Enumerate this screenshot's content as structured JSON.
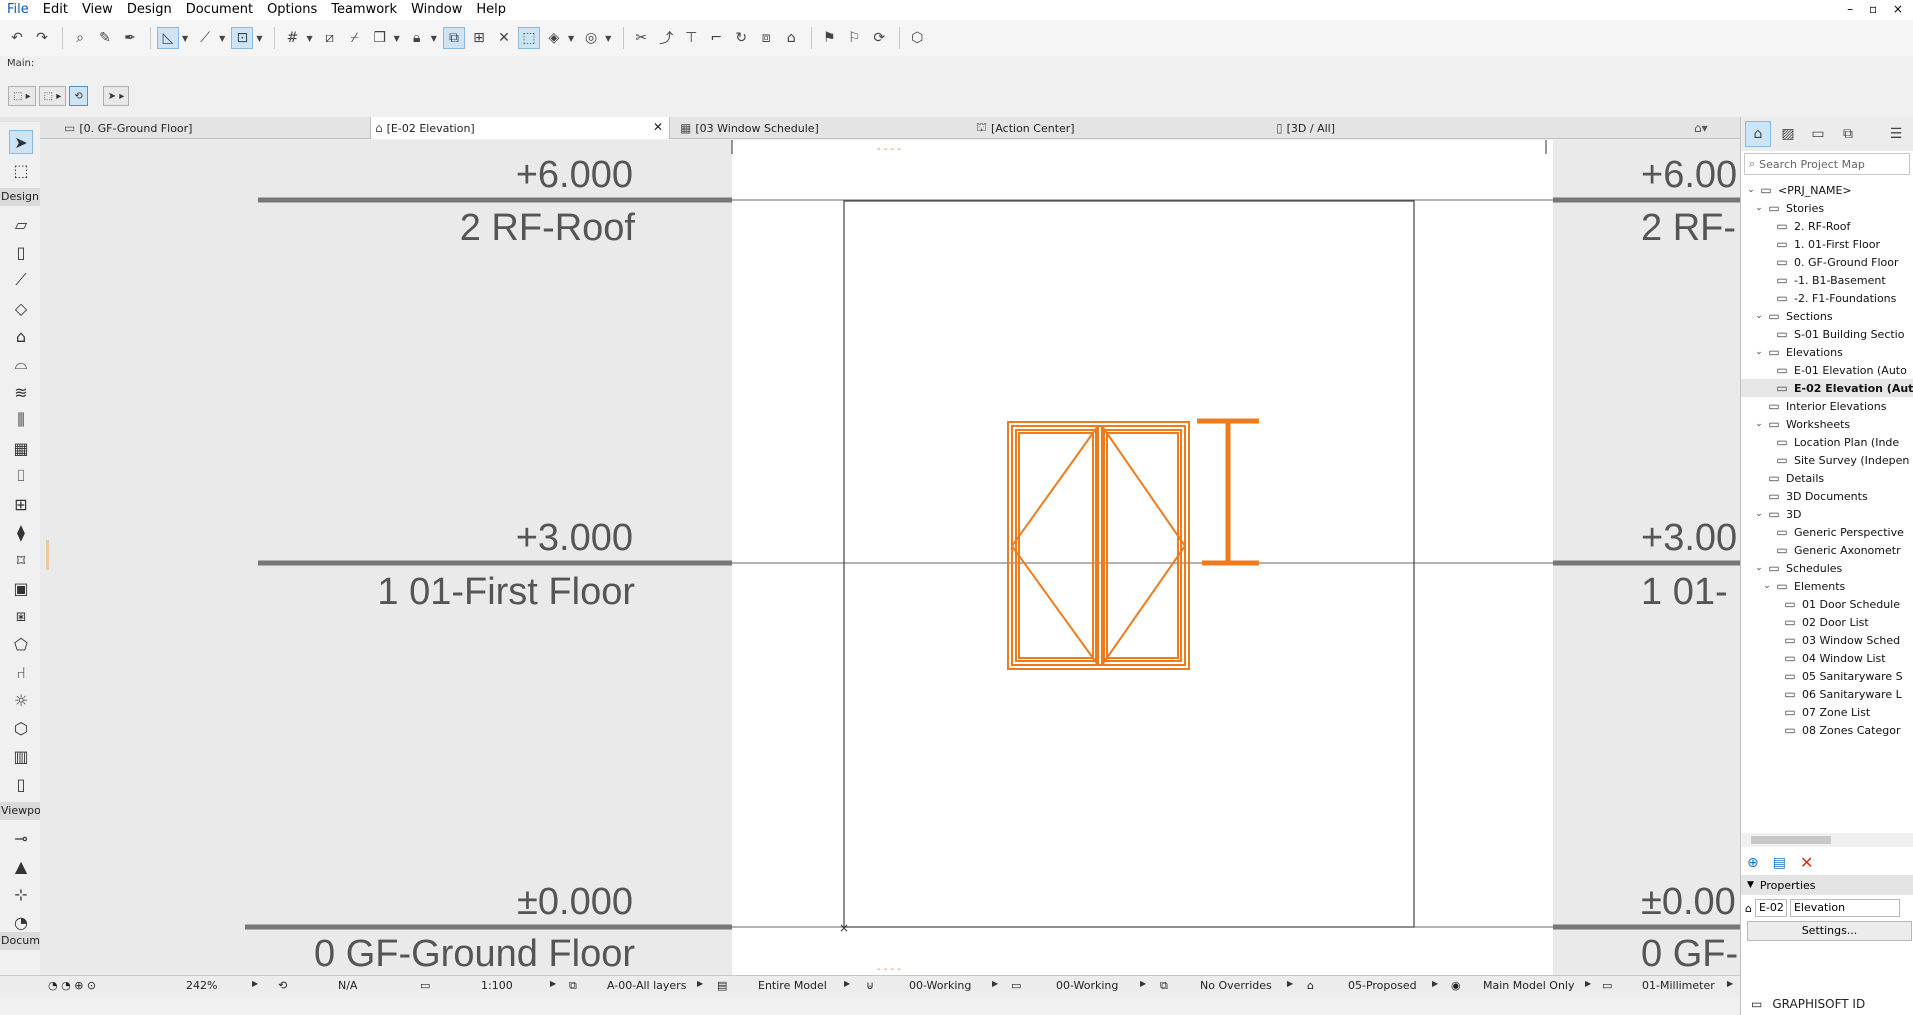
{
  "menubar": {
    "items": [
      "File",
      "Edit",
      "View",
      "Design",
      "Document",
      "Options",
      "Teamwork",
      "Window",
      "Help"
    ],
    "window_controls": "– ▫ ×"
  },
  "toolbar": {
    "main_label": "Main:"
  },
  "tabs": [
    {
      "label": "[0. GF-Ground Floor]",
      "icon": "floor-plan-icon"
    },
    {
      "label": "[E-02 Elevation]",
      "icon": "elevation-icon",
      "active": true
    },
    {
      "label": "[03 Window Schedule]",
      "icon": "schedule-icon"
    },
    {
      "label": "[Action Center]",
      "icon": "action-center-icon"
    },
    {
      "label": "[3D / All]",
      "icon": "3d-icon"
    }
  ],
  "left_toolbox": {
    "design_label": "Design",
    "viewpoint_label": "Viewpoi",
    "document_label": "Docume"
  },
  "canvas": {
    "levels_left": [
      {
        "elevation": "+6.000",
        "name": "2 RF-Roof"
      },
      {
        "elevation": "+3.000",
        "name": "1 01-First Floor"
      },
      {
        "elevation": "±0.000",
        "name": "0 GF-Ground Floor"
      }
    ],
    "levels_right": [
      {
        "elevation": "+6.00",
        "name": "2 RF-"
      },
      {
        "elevation": "+3.00",
        "name": "1 01-"
      },
      {
        "elevation": "±0.00",
        "name": "0 GF-"
      }
    ],
    "highlight_color": "#f07b1c"
  },
  "navigator": {
    "search_placeholder": "Search Project Map",
    "tree": [
      {
        "label": "<PRJ_NAME>",
        "level": 0,
        "caret": "v",
        "icon": "project-icon"
      },
      {
        "label": "Stories",
        "level": 1,
        "caret": "v",
        "icon": "stories-icon"
      },
      {
        "label": "2. RF-Roof",
        "level": 2,
        "caret": "",
        "icon": "story-icon"
      },
      {
        "label": "1. 01-First Floor",
        "level": 2,
        "caret": "",
        "icon": "story-icon"
      },
      {
        "label": "0. GF-Ground Floor",
        "level": 2,
        "caret": "",
        "icon": "story-icon"
      },
      {
        "label": "-1. B1-Basement",
        "level": 2,
        "caret": "",
        "icon": "story-icon"
      },
      {
        "label": "-2. F1-Foundations",
        "level": 2,
        "caret": "",
        "icon": "story-icon"
      },
      {
        "label": "Sections",
        "level": 1,
        "caret": "v",
        "icon": "section-icon"
      },
      {
        "label": "S-01 Building Sectio",
        "level": 2,
        "caret": "",
        "icon": "section-icon"
      },
      {
        "label": "Elevations",
        "level": 1,
        "caret": "v",
        "icon": "elevation-icon"
      },
      {
        "label": "E-01 Elevation (Auto",
        "level": 2,
        "caret": "",
        "icon": "elevation-icon"
      },
      {
        "label": "E-02 Elevation (Aut",
        "level": 2,
        "caret": "",
        "icon": "elevation-icon",
        "selected": true
      },
      {
        "label": "Interior Elevations",
        "level": 1,
        "caret": "",
        "icon": "interior-elevation-icon"
      },
      {
        "label": "Worksheets",
        "level": 1,
        "caret": "v",
        "icon": "worksheet-icon"
      },
      {
        "label": "Location Plan (Inde",
        "level": 2,
        "caret": "",
        "icon": "worksheet-icon"
      },
      {
        "label": "Site Survey (Indepen",
        "level": 2,
        "caret": "",
        "icon": "worksheet-icon"
      },
      {
        "label": "Details",
        "level": 1,
        "caret": "",
        "icon": "details-icon"
      },
      {
        "label": "3D Documents",
        "level": 1,
        "caret": "",
        "icon": "3d-document-icon"
      },
      {
        "label": "3D",
        "level": 1,
        "caret": "v",
        "icon": "3d-icon"
      },
      {
        "label": "Generic Perspective",
        "level": 2,
        "caret": "",
        "icon": "perspective-icon"
      },
      {
        "label": "Generic Axonometr",
        "level": 2,
        "caret": "",
        "icon": "axonometry-icon"
      },
      {
        "label": "Schedules",
        "level": 1,
        "caret": "v",
        "icon": "schedule-icon"
      },
      {
        "label": "Elements",
        "level": 2,
        "caret": "v",
        "icon": "elements-icon"
      },
      {
        "label": "01 Door Schedule",
        "level": 3,
        "caret": "",
        "icon": "schedule-icon"
      },
      {
        "label": "02 Door List",
        "level": 3,
        "caret": "",
        "icon": "schedule-icon"
      },
      {
        "label": "03 Window Sched",
        "level": 3,
        "caret": "",
        "icon": "schedule-icon"
      },
      {
        "label": "04 Window List",
        "level": 3,
        "caret": "",
        "icon": "schedule-icon"
      },
      {
        "label": "05 Sanitaryware S",
        "level": 3,
        "caret": "",
        "icon": "schedule-icon"
      },
      {
        "label": "06 Sanitaryware L",
        "level": 3,
        "caret": "",
        "icon": "schedule-icon"
      },
      {
        "label": "07 Zone List",
        "level": 3,
        "caret": "",
        "icon": "schedule-icon"
      },
      {
        "label": "08 Zones Categor",
        "level": 3,
        "caret": "",
        "icon": "schedule-icon"
      }
    ],
    "properties_label": "Properties",
    "prop_id": "E-02",
    "prop_name": "Elevation",
    "settings_label": "Settings...",
    "brand": "GRAPHISOFT ID"
  },
  "statusbar": {
    "zoom": "242%",
    "na": "N/A",
    "scale": "1:100",
    "layers": "A-00-All layers",
    "model": "Entire Model",
    "pen_set": "00-Working",
    "model_view": "00-Working",
    "overrides": "No Overrides",
    "renovation": "05-Proposed",
    "mvo": "Main Model Only",
    "dimension": "01-Millimeter"
  }
}
